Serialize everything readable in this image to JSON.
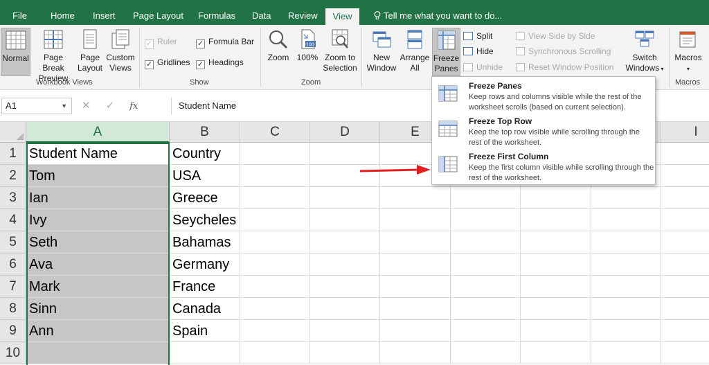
{
  "menu": {
    "tabs": [
      "File",
      "Home",
      "Insert",
      "Page Layout",
      "Formulas",
      "Data",
      "Review",
      "View"
    ],
    "active_tab": "View",
    "tell_me": "Tell me what you want to do..."
  },
  "ribbon": {
    "workbook_views": {
      "label": "Workbook Views",
      "normal": "Normal",
      "page_break_1": "Page Break",
      "page_break_2": "Preview",
      "page_layout_1": "Page",
      "page_layout_2": "Layout",
      "custom_1": "Custom",
      "custom_2": "Views"
    },
    "show": {
      "label": "Show",
      "ruler": "Ruler",
      "gridlines": "Gridlines",
      "formula_bar": "Formula Bar",
      "headings": "Headings"
    },
    "zoom": {
      "label": "Zoom",
      "zoom": "Zoom",
      "hundred": "100%",
      "zoom_sel_1": "Zoom to",
      "zoom_sel_2": "Selection"
    },
    "window": {
      "new_1": "New",
      "new_2": "Window",
      "arrange_1": "Arrange",
      "arrange_2": "All",
      "freeze_1": "Freeze",
      "freeze_2": "Panes",
      "split": "Split",
      "hide": "Hide",
      "unhide": "Unhide",
      "side_by_side": "View Side by Side",
      "sync_scroll": "Synchronous Scrolling",
      "reset_pos": "Reset Window Position",
      "switch_1": "Switch",
      "switch_2": "Windows"
    },
    "macros": {
      "label": "Macros",
      "macros": "Macros"
    }
  },
  "formula_bar": {
    "name_box": "A1",
    "content": "Student  Name"
  },
  "sheet": {
    "columns": [
      "A",
      "B",
      "C",
      "D",
      "E",
      "F",
      "G",
      "H",
      "I"
    ],
    "rows": [
      "1",
      "2",
      "3",
      "4",
      "5",
      "6",
      "7",
      "8",
      "9",
      "10"
    ],
    "colA": [
      "Student  Name",
      "Tom",
      "Ian",
      "Ivy",
      "Seth",
      "Ava",
      "Mark",
      "Sinn",
      "Ann",
      ""
    ],
    "colB": [
      "Country",
      "USA",
      "Greece",
      "Seycheles",
      "Bahamas",
      "Germany",
      "France",
      "Canada",
      "Spain",
      ""
    ]
  },
  "freeze_menu": {
    "items": [
      {
        "title": "Freeze Panes",
        "desc": "Keep rows and columns visible while the rest of the worksheet scrolls (based on current selection)."
      },
      {
        "title": "Freeze Top Row",
        "desc": "Keep the top row visible while scrolling through the rest of the worksheet."
      },
      {
        "title": "Freeze First Column",
        "desc": "Keep the first column visible while scrolling through the rest of the worksheet."
      }
    ]
  },
  "colors": {
    "excel_green": "#217346",
    "selection_fill": "#c6c6c6",
    "arrow_red": "#e02020"
  }
}
